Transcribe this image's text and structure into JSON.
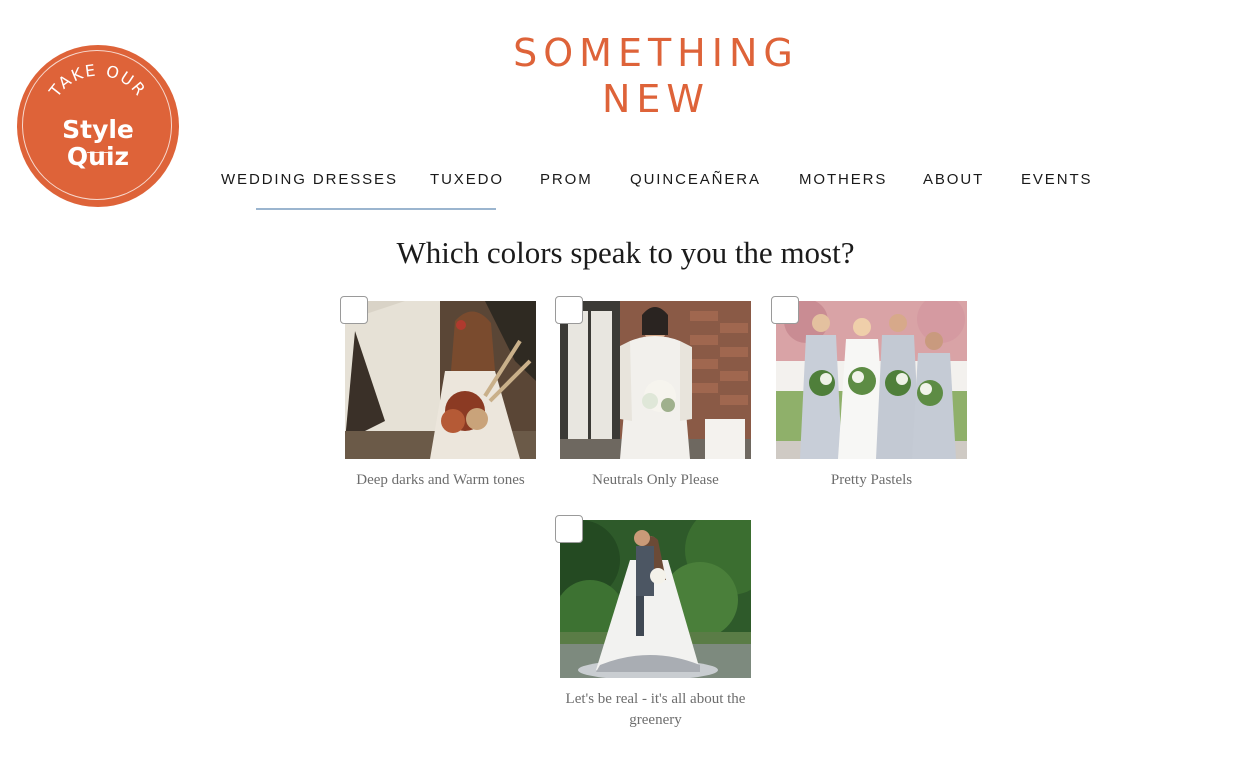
{
  "badge": {
    "top_text": "TAKE OUR",
    "line1": "Style",
    "line2": "Quiz"
  },
  "logo": {
    "line1": "SOMETHING",
    "line2": "NEW",
    "color": "#de6339"
  },
  "nav": {
    "items": [
      "WEDDING DRESSES",
      "TUXEDO",
      "PROM",
      "QUINCEAÑERA",
      "MOTHERS",
      "ABOUT",
      "EVENTS"
    ],
    "underline_color": "#9bb5cf"
  },
  "question": "Which colors speak to you the most?",
  "options": [
    {
      "label": "Deep darks and Warm tones",
      "image": "bride-boho-warm-photo",
      "checked": false
    },
    {
      "label": "Neutrals Only Please",
      "image": "bride-neutral-photo",
      "checked": false
    },
    {
      "label": "Pretty Pastels",
      "image": "bridesmaids-pastel-photo",
      "checked": false
    },
    {
      "label": "Let's be real - it's all about the greenery",
      "image": "couple-greenery-photo",
      "checked": false
    }
  ]
}
